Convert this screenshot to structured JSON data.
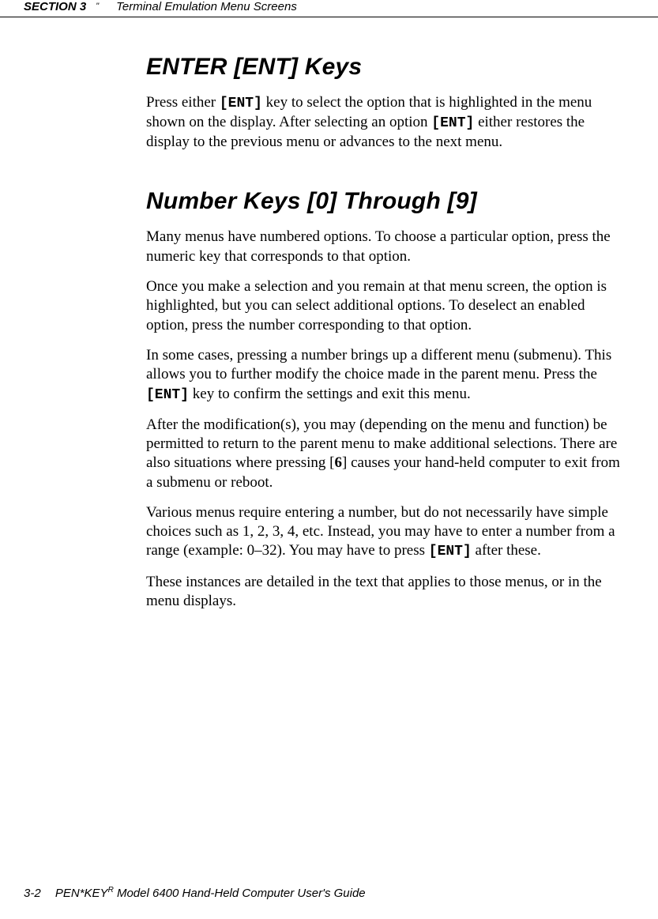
{
  "header": {
    "section": "SECTION 3",
    "quote": "\"",
    "title": "Terminal Emulation Menu Screens"
  },
  "headings": {
    "enter": "ENTER [ENT] Keys",
    "number": "Number Keys [0] Through [9]"
  },
  "paragraphs": {
    "p1_a": "Press either ",
    "p1_key1": "[ENT]",
    "p1_b": " key to select the option that is high­lighted in the menu shown on the display.  After selecting an option ",
    "p1_key2": "[ENT]",
    "p1_c": " either restores the display to the previous menu or advances to the next menu.",
    "p2": "Many menus have numbered options.  To choose a particu­lar option, press the numeric key that corresponds to that option.",
    "p3": "Once you make a selection and you remain at that menu screen, the option is highlighted, but you can select addi­tional options.  To deselect an enabled option, press the number corresponding to that option.",
    "p4_a": "In some cases, pressing a number brings up a different menu (submenu).  This allows you to further modify the choice made in the parent menu.  Press the ",
    "p4_key": "[ENT]",
    "p4_b": " key to confirm the settings and exit this menu.",
    "p5_a": "After the modification(s), you may (depending on the menu and function) be permitted to return to the parent menu to make additional selections.  There are also situations where pressing [",
    "p5_num": "6",
    "p5_b": "] causes your hand-held computer to exit from a submenu or reboot.",
    "p6_a": "Various menus require entering a number, but do not neces­sarily have simple choices such as 1, 2, 3, 4, etc.  Instead, you may have to enter a number from a range (example: 0–32).  You may have to press ",
    "p6_key": "[ENT]",
    "p6_b": " after these.",
    "p7": "These instances are detailed in the text that applies to those menus, or in the menu displays."
  },
  "footer": {
    "page": "3-2",
    "text_a": "PEN*KEY",
    "sup": "R",
    "text_b": " Model 6400 Hand-Held Computer User's Guide"
  }
}
